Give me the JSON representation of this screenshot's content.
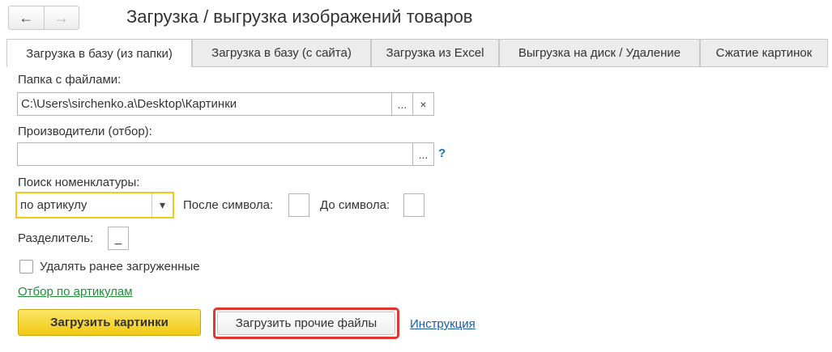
{
  "window": {
    "title": "Загрузка / выгрузка изображений товаров",
    "back_icon": "arrow-left-icon",
    "forward_icon": "arrow-right-icon"
  },
  "tabs": [
    {
      "label": "Загрузка в базу (из папки)",
      "active": true
    },
    {
      "label": "Загрузка в базу (с сайта)",
      "active": false
    },
    {
      "label": "Загрузка из Excel",
      "active": false
    },
    {
      "label": "Выгрузка на диск / Удаление",
      "active": false
    },
    {
      "label": "Сжатие картинок",
      "active": false
    }
  ],
  "folder": {
    "label": "Папка с файлами:",
    "value": "C:\\Users\\sirchenko.a\\Desktop\\Картинки",
    "select_button": "...",
    "clear_button": "×"
  },
  "manufacturers": {
    "label": "Производители (отбор):",
    "value": "",
    "select_button": "...",
    "help": "?"
  },
  "search": {
    "label": "Поиск номенклатуры:",
    "value": "по артикулу",
    "after_symbol_label": "После символа:",
    "after_symbol_value": "",
    "before_symbol_label": "До символа:",
    "before_symbol_value": ""
  },
  "separator": {
    "label": "Разделитель:",
    "value": "_"
  },
  "delete_previous": {
    "label": "Удалять ранее загруженные",
    "checked": false
  },
  "filter_link": "Отбор по артикулам",
  "actions": {
    "load_images": "Загрузить картинки",
    "load_other_files": "Загрузить прочие файлы",
    "instruction": "Инструкция"
  },
  "colors": {
    "primary_button": "#f2c811",
    "focus_border": "#f5c815",
    "highlight_border": "#e0362d",
    "link_green": "#1f8f3a",
    "link_blue": "#1a5ca8"
  }
}
